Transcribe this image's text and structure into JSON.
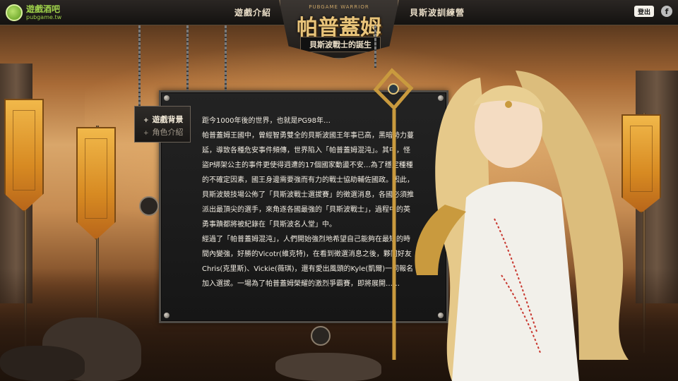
{
  "brand": {
    "name": "遊戲酒吧",
    "url": "pubgame.tw",
    "logo_icon": "speech-bubble-logo-icon"
  },
  "nav": {
    "left_label": "遊戲介紹",
    "right_label": "貝斯波訓練營"
  },
  "header_actions": {
    "logout_label": "登出",
    "facebook_icon": "facebook-icon"
  },
  "emblem": {
    "subtitle_en": "PUBGAME WARRIOR",
    "title": "帕普蓋姆",
    "subtitle": "貝斯波戰士的誕生"
  },
  "side_menu": {
    "items": [
      {
        "label": "遊戲背景",
        "active": true
      },
      {
        "label": "角色介紹",
        "active": false
      }
    ]
  },
  "story": {
    "paragraphs": [
      "距今1000年後的世界，也就是PG98年…",
      "帕普蓋姆王國中，曾經智勇雙全的貝斯波國王年事已高，黑暗勢力蔓延，導致各種危安事件頻傳，世界陷入「帕普蓋姆混沌」。其中，怪盜P綁架公主的事件更使得週遭的17個國家動盪不安…為了穩定種種的不確定因素，國王身邊需要強而有力的戰士協助輔佐國政。因此，貝斯波競技場公佈了「貝斯波戰士選拔賽」的徵選消息，各國必須推派出最頂尖的選手，來角逐各國最強的「貝斯波戰士」，過程中的英勇事蹟都將被紀錄在「貝斯波名人堂」中。",
      "經過了「帕普蓋姆混沌」，人們開始強烈地希望自己能夠在最短的時間內變強，好勝的Vicotr(維克特)，在看到徵選消息之後，夥同好友Chris(克里斯)、Vickie(薇琪)，還有愛出風頭的Kyle(凱爾)一同報名加入選拔。一場為了帕普蓋姆榮耀的激烈爭霸賽，即將展開……"
    ]
  },
  "colors": {
    "brand_green": "#9fd24b",
    "gold": "#e9c47a",
    "panel_bg": "#1c1c1c",
    "banner_orange": "#e09a2c"
  }
}
